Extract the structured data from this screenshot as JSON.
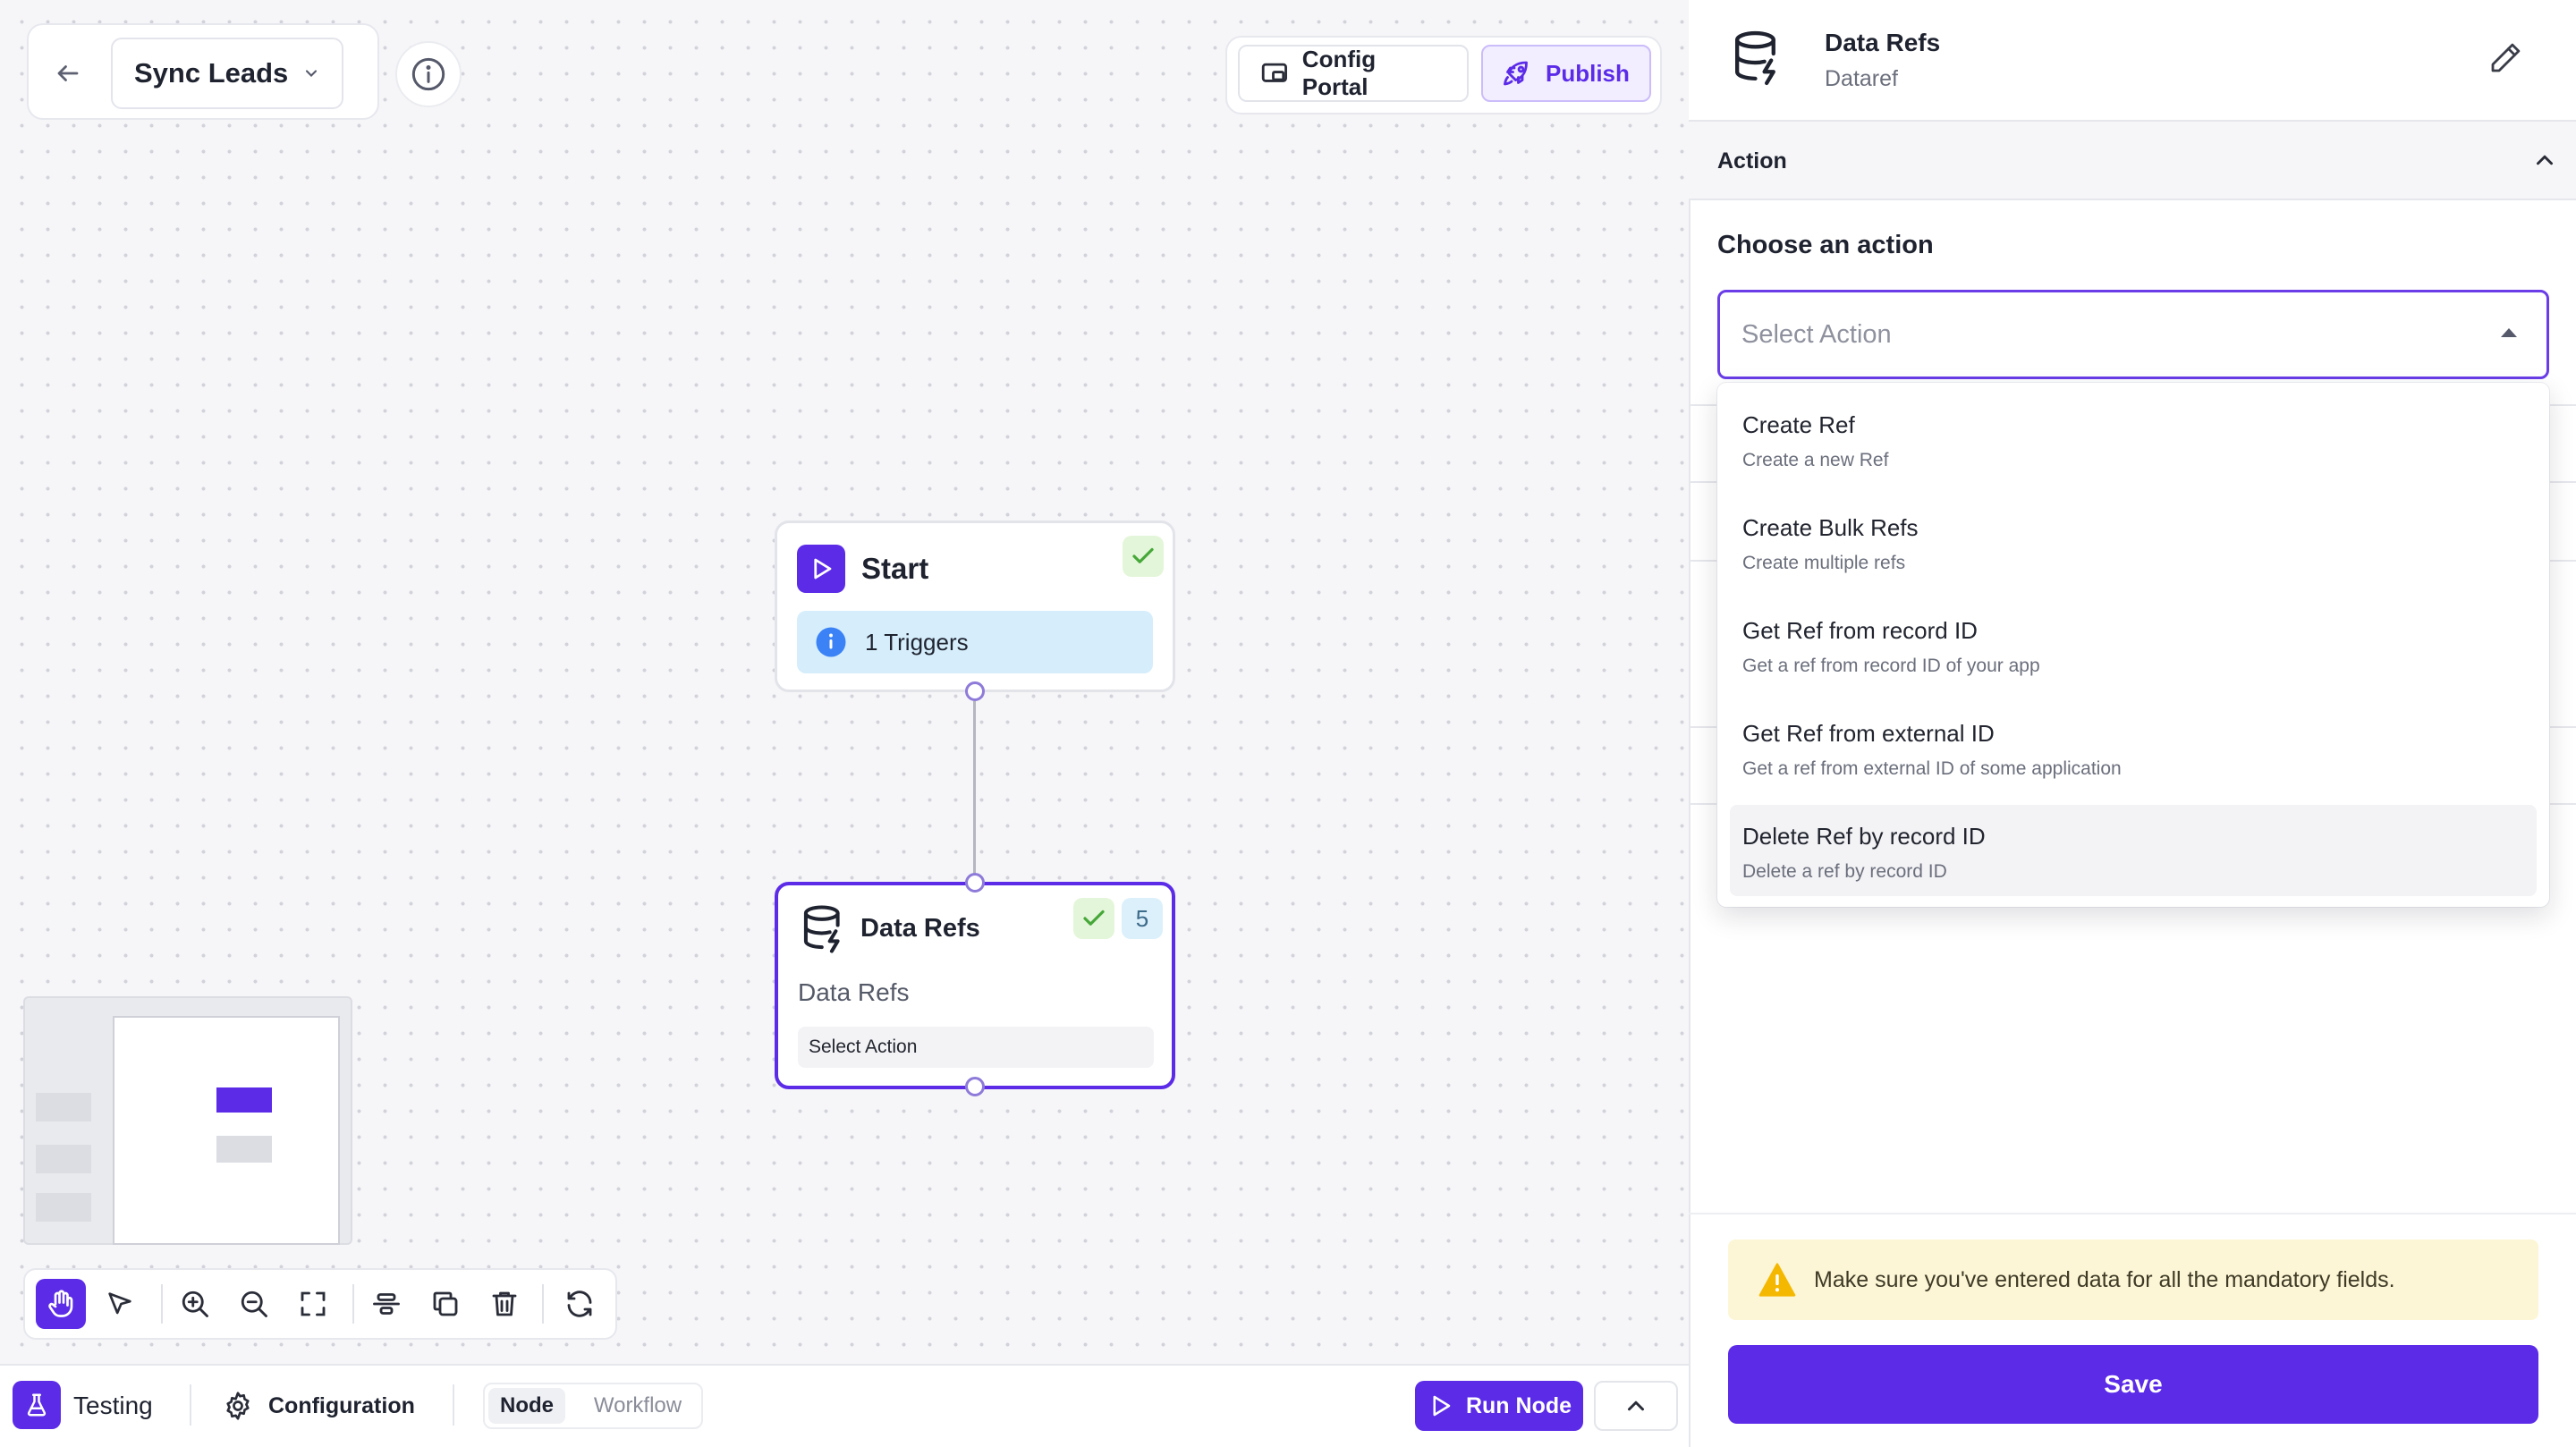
{
  "workflow": {
    "name": "Sync Leads"
  },
  "top_actions": {
    "config_portal": "Config Portal",
    "publish": "Publish"
  },
  "nodes": {
    "start": {
      "title": "Start",
      "triggers": "1 Triggers",
      "status": "complete"
    },
    "data_refs": {
      "title": "Data Refs",
      "subtitle": "Data Refs",
      "action": "Select Action",
      "count": "5",
      "status": "complete"
    }
  },
  "bottom_bar": {
    "testing": "Testing",
    "configuration": "Configuration",
    "mode_node": "Node",
    "mode_workflow": "Workflow",
    "selected_mode": "Node",
    "run_node": "Run Node"
  },
  "toolbar": {
    "tools": [
      "hand-icon",
      "pointer-icon",
      "zoom-in-icon",
      "zoom-out-icon",
      "fit-view-icon",
      "align-icon",
      "duplicate-icon",
      "delete-icon",
      "refresh-icon"
    ],
    "active_tool": "hand-icon"
  },
  "panel": {
    "title": "Data Refs",
    "subtitle": "Dataref",
    "section": "Action",
    "choose_label": "Choose an action",
    "select_placeholder": "Select Action",
    "options": [
      {
        "title": "Create Ref",
        "desc": "Create a new Ref"
      },
      {
        "title": "Create Bulk Refs",
        "desc": "Create multiple refs"
      },
      {
        "title": "Get Ref from record ID",
        "desc": "Get a ref from record ID of your app"
      },
      {
        "title": "Get Ref from external ID",
        "desc": "Get a ref from external ID of some application"
      },
      {
        "title": "Delete Ref by record ID",
        "desc": "Delete a ref by record ID"
      }
    ],
    "hovered_option": "Delete Ref by record ID",
    "warning": "Make sure you've entered data for all the mandatory fields.",
    "save": "Save"
  },
  "colors": {
    "accent": "#5b2be8",
    "success_bg": "#e4f6d9",
    "success": "#47a83a",
    "info_bg": "#d6eefb",
    "info": "#3b82f6",
    "warning_bg": "#fdf6d6",
    "warning": "#f5b800"
  }
}
